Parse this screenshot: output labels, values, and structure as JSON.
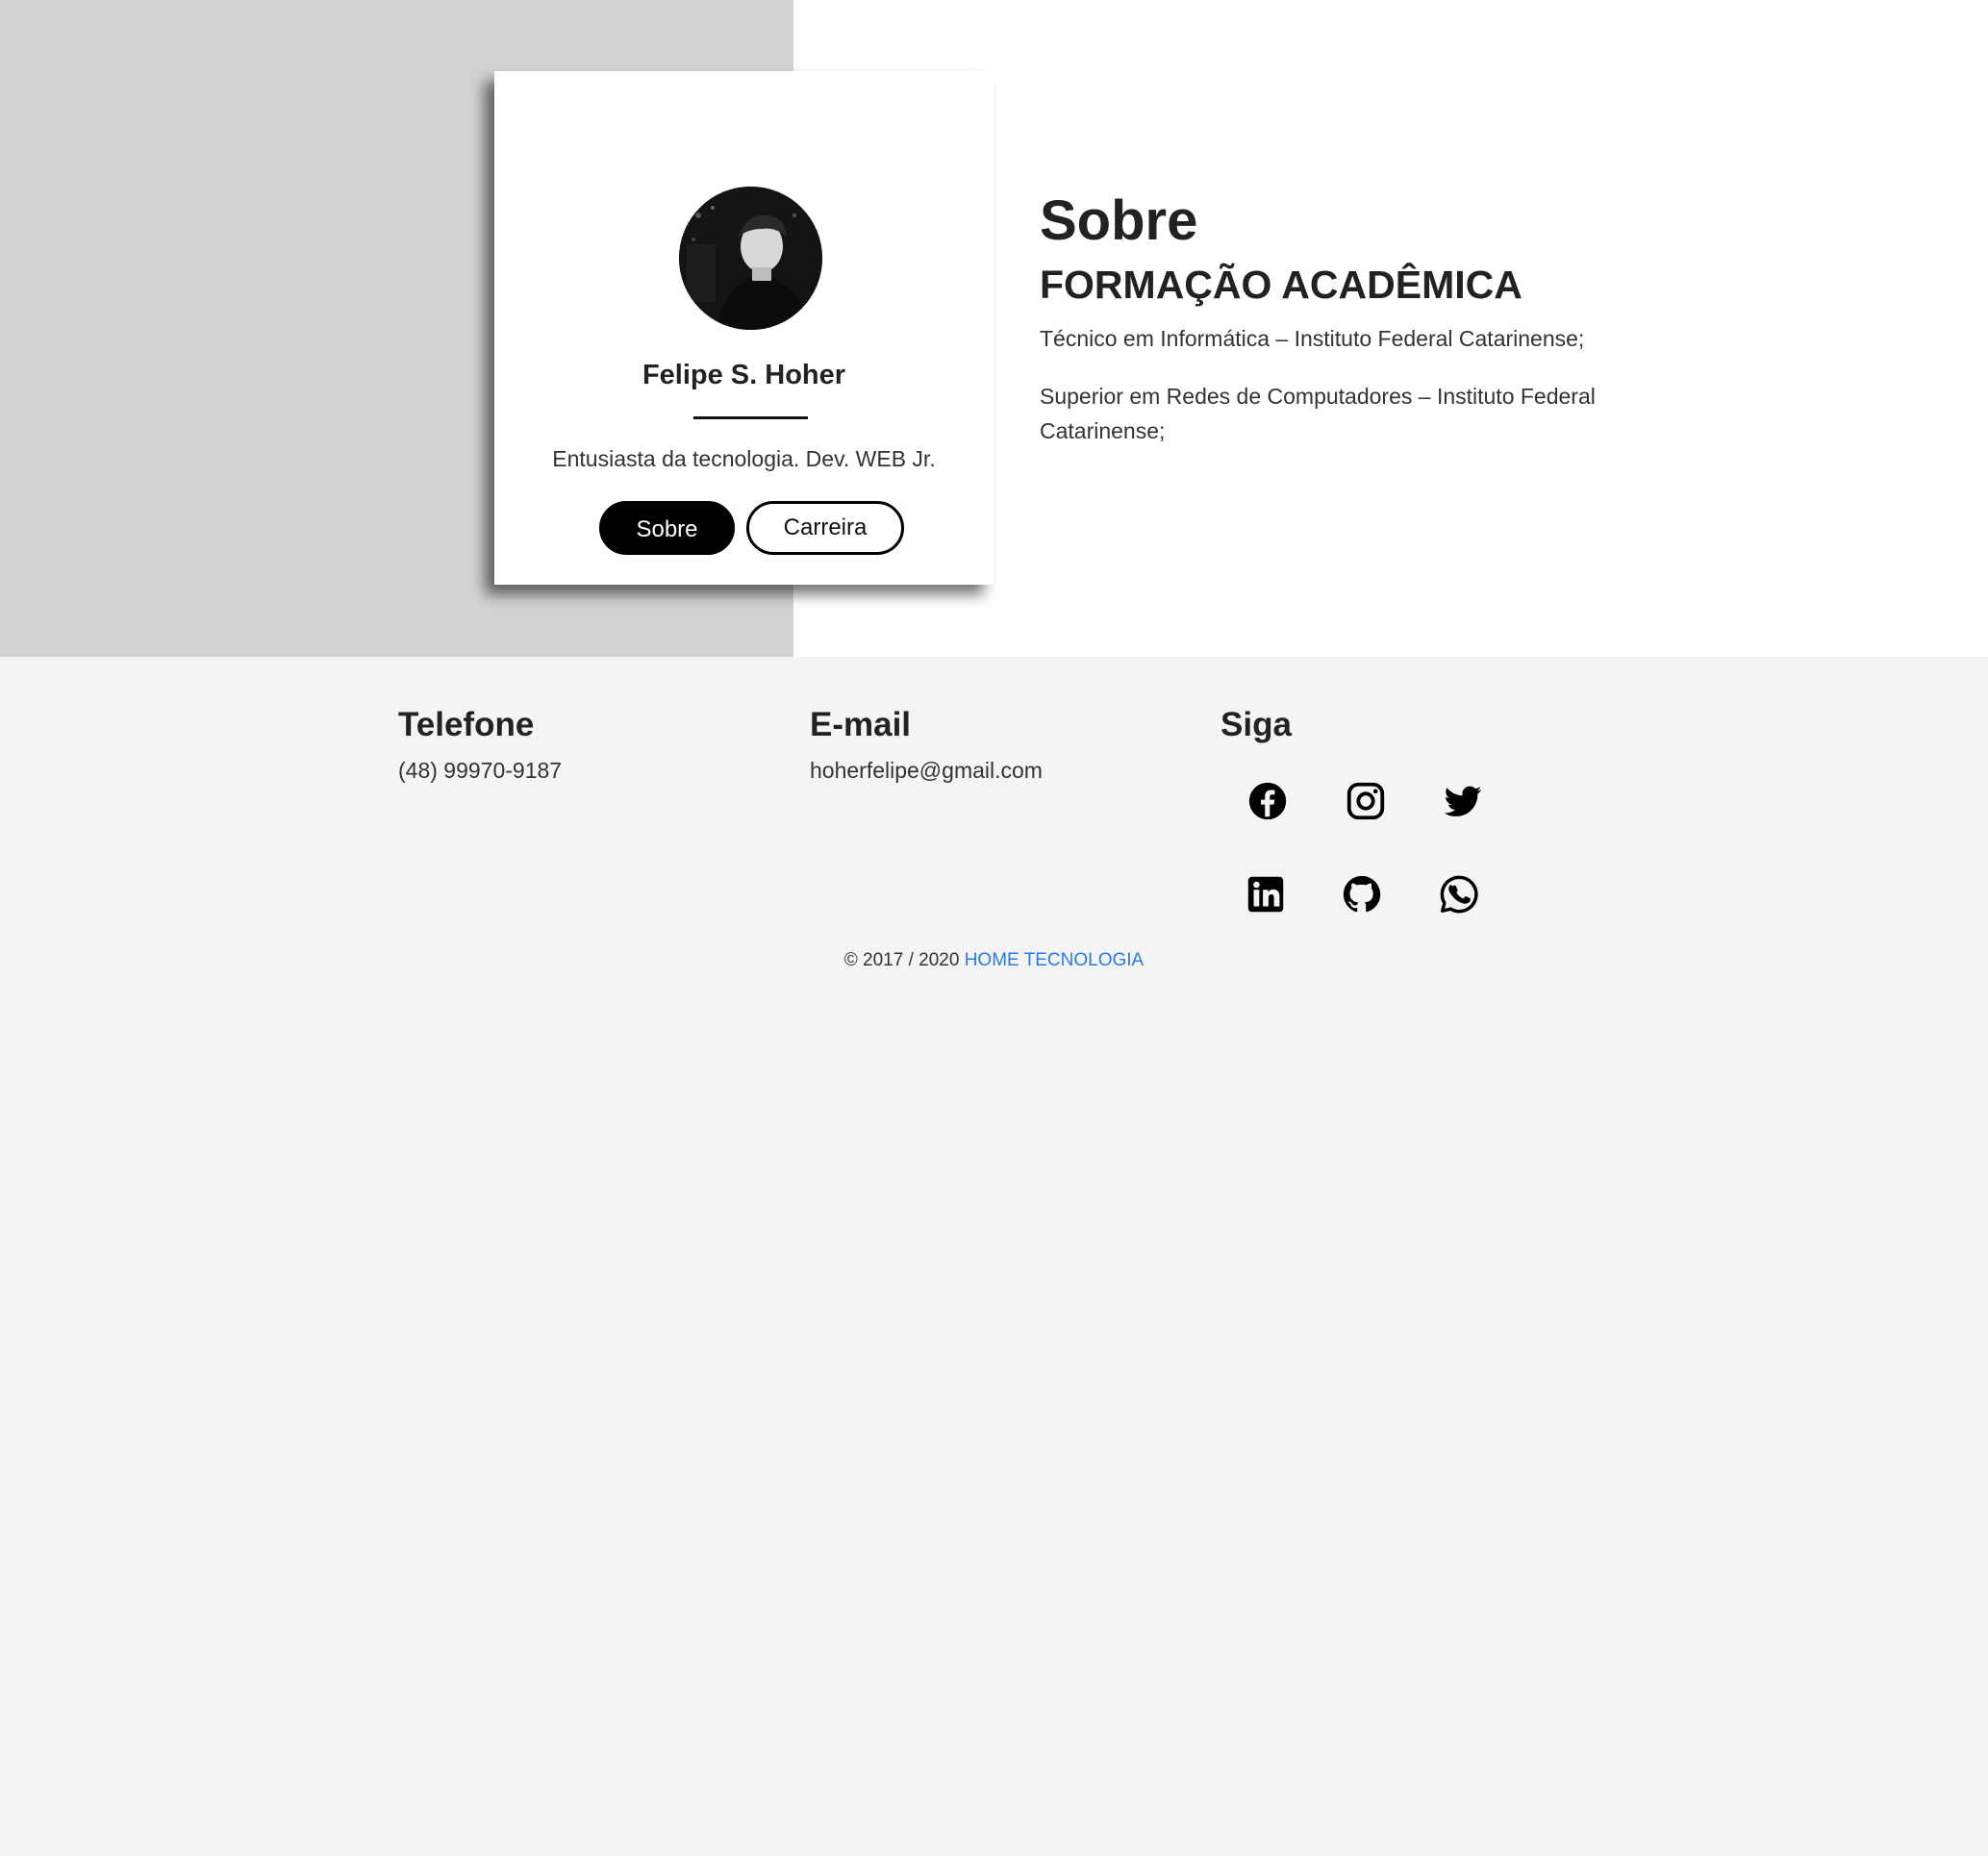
{
  "profile": {
    "avatar_alt": "Felipe S. Hoher",
    "name": "Felipe S. Hoher",
    "tagline": "Entusiasta da tecnologia. Dev. WEB Jr.",
    "buttons": {
      "about": "Sobre",
      "career": "Carreira"
    }
  },
  "about": {
    "title": "Sobre",
    "subtitle": "FORMAÇÃO ACADÊMICA",
    "items": [
      "Técnico em Informática – Instituto Federal Catarinense;",
      "Superior em Redes de Computadores – Instituto Federal Catarinense;"
    ]
  },
  "footer": {
    "phone": {
      "heading": "Telefone",
      "value": "(48) 99970-9187"
    },
    "email": {
      "heading": "E-mail",
      "value": "hoherfelipe@gmail.com"
    },
    "follow": {
      "heading": "Siga",
      "icons": [
        "facebook-icon",
        "instagram-icon",
        "twitter-icon",
        "linkedin-icon",
        "github-icon",
        "whatsapp-icon"
      ]
    },
    "copyright_prefix": "© 2017 / 2020",
    "copyright_link": "HOME TECNOLOGIA"
  },
  "colors": {
    "page_bg": "#f4f4f4",
    "hero_left_bg": "#d3d3d3",
    "link": "#2a7ae2",
    "button_dark": "#000000"
  }
}
